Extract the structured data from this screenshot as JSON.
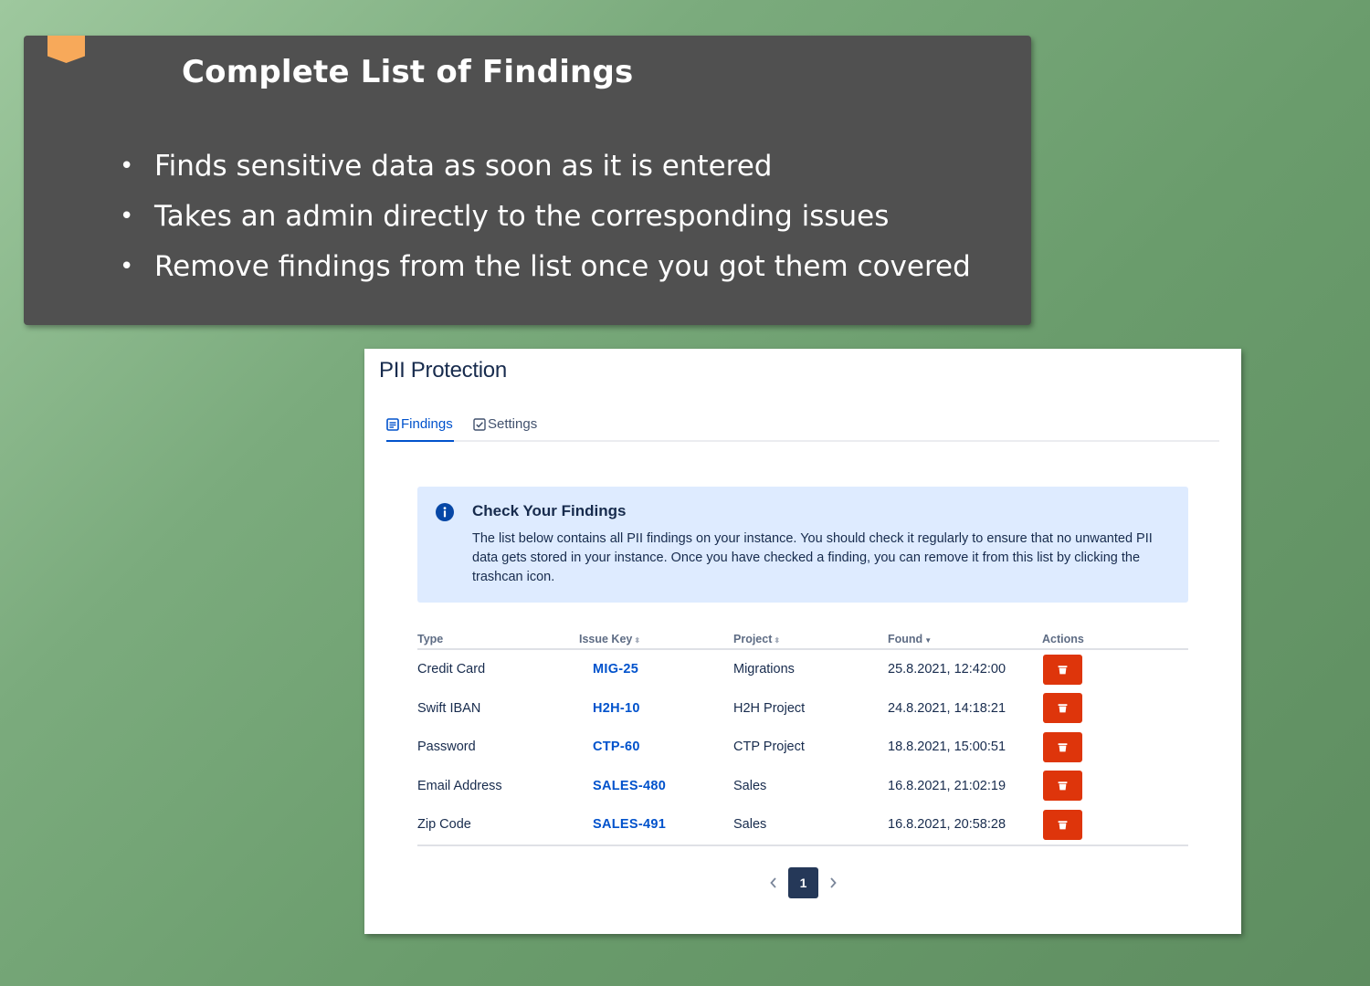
{
  "slide": {
    "title": "Complete List of Findings",
    "bullets": [
      "Finds sensitive data as soon as it is entered",
      "Takes an admin directly to the corresponding issues",
      "Remove findings from the list once you got them covered"
    ],
    "accent_color": "#f7a95a"
  },
  "app": {
    "title": "PII Protection",
    "tabs": [
      {
        "label": "Findings",
        "icon": "list-icon",
        "active": true
      },
      {
        "label": "Settings",
        "icon": "checkbox-icon",
        "active": false
      }
    ],
    "info": {
      "icon": "info-icon",
      "title": "Check Your Findings",
      "body": "The list below contains all PII findings on your instance. You should check it regularly to ensure that no unwanted PII data gets stored in your instance. Once you have checked a finding, you can remove it from this list by clicking the trashcan icon."
    },
    "table": {
      "headers": {
        "type": "Type",
        "issue_key": "Issue Key",
        "project": "Project",
        "found": "Found",
        "actions": "Actions"
      },
      "rows": [
        {
          "type": "Credit Card",
          "issue_key": "MIG-25",
          "project": "Migrations",
          "found": "25.8.2021, 12:42:00"
        },
        {
          "type": "Swift IBAN",
          "issue_key": "H2H-10",
          "project": "H2H Project",
          "found": "24.8.2021, 14:18:21"
        },
        {
          "type": "Password",
          "issue_key": "CTP-60",
          "project": "CTP Project",
          "found": "18.8.2021, 15:00:51"
        },
        {
          "type": "Email Address",
          "issue_key": "SALES-480",
          "project": "Sales",
          "found": "16.8.2021, 21:02:19"
        },
        {
          "type": "Zip Code",
          "issue_key": "SALES-491",
          "project": "Sales",
          "found": "16.8.2021, 20:58:28"
        }
      ]
    },
    "pagination": {
      "current": "1"
    },
    "colors": {
      "link": "#0052cc",
      "danger": "#de350b",
      "info_bg": "#deebff",
      "text": "#172b4d"
    }
  }
}
